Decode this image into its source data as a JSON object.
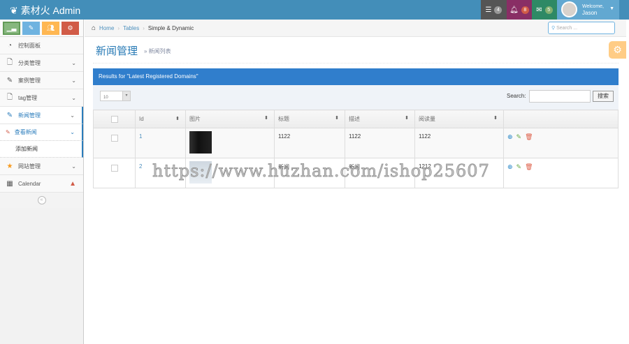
{
  "header": {
    "brand": "素材火 Admin",
    "tasks_count": "4",
    "notifications_count": "8",
    "messages_count": "5",
    "welcome": "Welcome,",
    "user": "Jason"
  },
  "sidebar": {
    "items": [
      {
        "label": "控制面板"
      },
      {
        "label": "分类管理"
      },
      {
        "label": "案例管理"
      },
      {
        "label": "tag管理"
      },
      {
        "label": "新闻管理"
      },
      {
        "label": "查看新闻"
      },
      {
        "label": "添加新闻"
      },
      {
        "label": "网站管理"
      },
      {
        "label": "Calendar"
      }
    ]
  },
  "breadcrumb": {
    "home": "Home",
    "tables": "Tables",
    "current": "Simple & Dynamic"
  },
  "nav_search": {
    "placeholder": "Search ..."
  },
  "page": {
    "title": "新闻管理",
    "subtitle": "» 新闻列表"
  },
  "table_title": "Results for \"Latest Registered Domains\"",
  "toolbar": {
    "page_size": "10",
    "search_label": "Search:",
    "search_button": "搜索"
  },
  "table": {
    "headers": [
      "Id",
      "图片",
      "标题",
      "描述",
      "阅读量"
    ],
    "rows": [
      {
        "id": "1",
        "title": "1122",
        "desc": "1122",
        "views": "1122"
      },
      {
        "id": "2",
        "title": "新闻",
        "desc": "新闻",
        "views": "1212"
      }
    ]
  },
  "watermark": "https://www.huzhan.com/ishop25607"
}
